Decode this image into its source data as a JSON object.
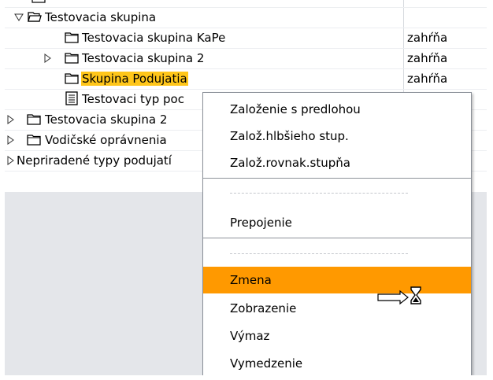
{
  "tree": {
    "top_row_partial": "Doh...",
    "items": [
      {
        "label": "Testovacia skupina",
        "col2": "",
        "icon": "open-folder-icon",
        "expander": "expanded-arrow-icon"
      },
      {
        "label": "Testovacia skupina KaPe",
        "col2": "zahŕňa",
        "icon": "folder-icon",
        "expander": ""
      },
      {
        "label": "Testovacia skupina 2",
        "col2": "zahŕňa",
        "icon": "folder-icon",
        "expander": "collapsed-arrow-icon"
      },
      {
        "label": "Skupina Podujatia",
        "col2": "zahŕňa",
        "icon": "folder-icon",
        "expander": ""
      },
      {
        "label": "Testovaci typ poc",
        "col2": "",
        "icon": "document-icon",
        "expander": ""
      },
      {
        "label": "Testovacia skupina 2",
        "col2": "",
        "icon": "folder-icon",
        "expander": "collapsed-arrow-icon"
      },
      {
        "label": "Vodičské oprávnenia",
        "col2": "",
        "icon": "folder-icon",
        "expander": "collapsed-arrow-icon"
      },
      {
        "label": "Nepriradené typy podujatí",
        "col2": "",
        "icon": "",
        "expander": "collapsed-arrow-icon"
      }
    ]
  },
  "context_menu": {
    "items": [
      {
        "label": "Založenie s predlohou"
      },
      {
        "label": "Založ.hlbšieho stup."
      },
      {
        "label": "Založ.rovnak.stupňa"
      },
      {
        "label": "Prepojenie"
      },
      {
        "label": "Zmena",
        "active": true
      },
      {
        "label": "Zobrazenie"
      },
      {
        "label": "Výmaz"
      },
      {
        "label": "Vymedzenie"
      }
    ]
  },
  "colors": {
    "selection_highlight": "#ffc61a",
    "menu_active": "#ff9900",
    "background": "#e4e6ea"
  },
  "cursor": "busy-arrow-hourglass-icon"
}
